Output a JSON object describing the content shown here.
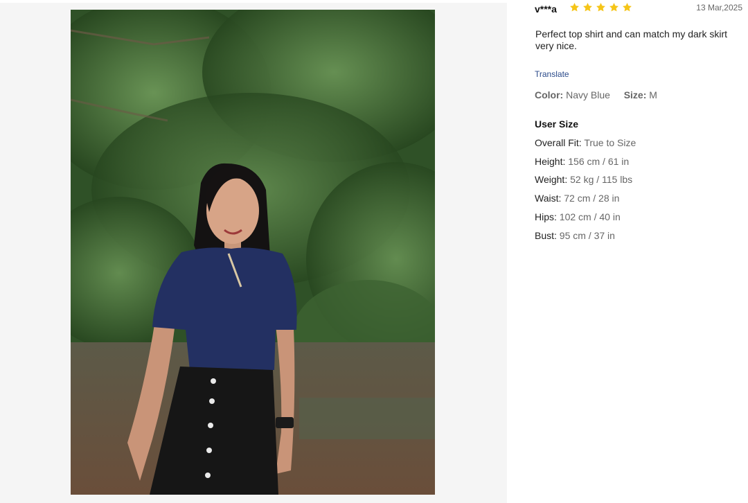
{
  "review": {
    "reviewer": "v***a",
    "rating": 5,
    "date": "13 Mar,2025",
    "text": "Perfect top shirt and can match my dark skirt very nice.",
    "translate_label": "Translate",
    "color_label": "Color:",
    "color_value": "Navy Blue",
    "size_label": "Size:",
    "size_value": "M",
    "user_size_title": "User Size",
    "user_size": [
      {
        "label": "Overall Fit:",
        "value": "True to Size"
      },
      {
        "label": "Height:",
        "value": "156 cm / 61 in"
      },
      {
        "label": "Weight:",
        "value": "52 kg / 115 lbs"
      },
      {
        "label": "Waist:",
        "value": "72 cm / 28 in"
      },
      {
        "label": "Hips:",
        "value": "102 cm / 40 in"
      },
      {
        "label": "Bust:",
        "value": "95 cm / 37 in"
      }
    ]
  },
  "colors": {
    "star": "#f5c518",
    "link": "#2a4a8a",
    "panel_bg": "#f5f5f5"
  }
}
